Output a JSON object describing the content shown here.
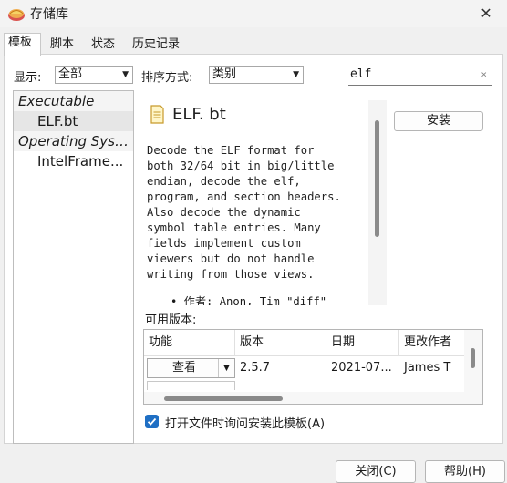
{
  "window": {
    "title": "存储库",
    "close_glyph": "✕"
  },
  "tabs": [
    {
      "label": "模板",
      "active": true
    },
    {
      "label": "脚本",
      "active": false
    },
    {
      "label": "状态",
      "active": false
    },
    {
      "label": "历史记录",
      "active": false
    }
  ],
  "filters": {
    "show_label": "显示:",
    "show_value": "全部",
    "sort_label": "排序方式:",
    "sort_value": "类别",
    "search_value": "elf",
    "clear_glyph": "×"
  },
  "tree": [
    {
      "kind": "category",
      "label": "Executable"
    },
    {
      "kind": "item",
      "label": "ELF.bt",
      "selected": true
    },
    {
      "kind": "category",
      "label": "Operating Syst..."
    },
    {
      "kind": "item",
      "label": "IntelFrame...",
      "selected": false
    }
  ],
  "detail": {
    "title": "ELF. bt",
    "icon": "document-icon",
    "description_lines": [
      "Decode the ELF format for",
      "both 32/64 bit in big/little",
      "endian, decode the elf,",
      "program, and section headers.",
      "Also decode the dynamic",
      "symbol table entries. Many",
      "fields implement custom",
      "viewers but do not handle",
      "writing from those views."
    ],
    "author_line": "• 作者: Anon, Tim \"diff\""
  },
  "install_label": "安装",
  "versions": {
    "label": "可用版本:",
    "headers": [
      "功能",
      "版本",
      "日期",
      "更改作者"
    ],
    "rows": [
      {
        "action": "查看",
        "version": "2.5.7",
        "date": "2021-07...",
        "author": "James T"
      }
    ]
  },
  "checkbox": {
    "label": "打开文件时询问安装此模板(A)",
    "checked": true
  },
  "buttons": {
    "close": "关闭(C)",
    "help": "帮助(H)"
  },
  "colors": {
    "accent": "#1f6fc4",
    "selection": "#e6e6e6"
  }
}
